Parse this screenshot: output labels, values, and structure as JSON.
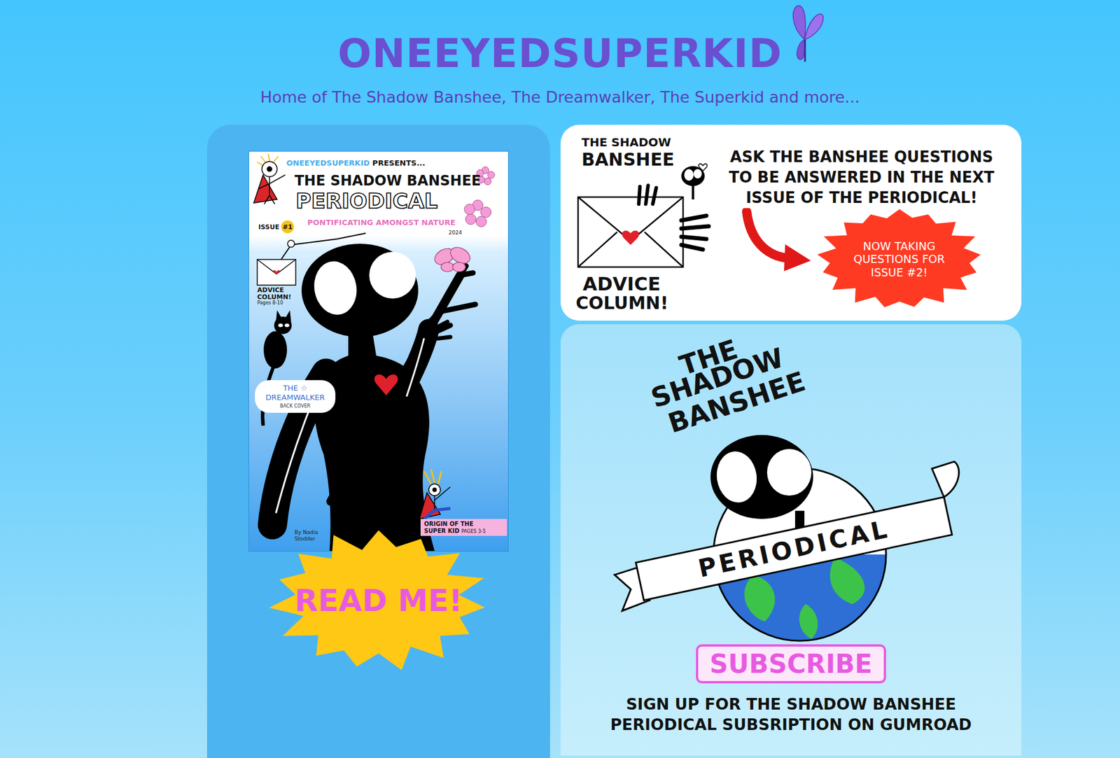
{
  "header": {
    "title": "ONEEYEDSUPERKID",
    "tagline": "Home of The Shadow Banshee, The Dreamwalker, The Superkid and more..."
  },
  "cover": {
    "brand": "ONEEYEDSUPERKID",
    "presents": "PRESENTS...",
    "title": "THE SHADOW BANSHEE",
    "subtitle": "PERIODICAL",
    "issue_label": "ISSUE",
    "issue_number": "#1",
    "tagline": "PONTIFICATING AMONGST NATURE",
    "year": "2024",
    "advice": "ADVICE COLUMN!",
    "advice_pages": "Pages 8-10",
    "dreamwalker_line1": "THE ☆",
    "dreamwalker_line2": "DREAMWALKER",
    "back_cover": "BACK COVER",
    "origin_line1": "ORIGIN OF THE",
    "origin_line2": "SUPER KID",
    "origin_pages": "PAGES 3-5",
    "byline_line1": "By Nadia",
    "byline_line2": "Stodder"
  },
  "read_button": "READ ME!",
  "advice_card": {
    "logo_top": "THE SHADOW",
    "logo_name": "BANSHEE",
    "logo_bottom1": "ADVICE",
    "logo_bottom2": "COLUMN!",
    "prompt": "ASK THE BANSHEE QUESTIONS TO BE ANSWERED IN THE NEXT ISSUE OF THE PERIODICAL!",
    "badge": "NOW TAKING QUESTIONS FOR ISSUE #2!"
  },
  "subscribe_card": {
    "logo_lines": [
      "THE",
      "SHADOW",
      "BANSHEE"
    ],
    "banner": "PERIODICAL",
    "button": "SUBSCRIBE",
    "note": "SIGN UP FOR THE SHADOW BANSHEE PERIODICAL SUBSRIPTION ON GUMROAD"
  }
}
